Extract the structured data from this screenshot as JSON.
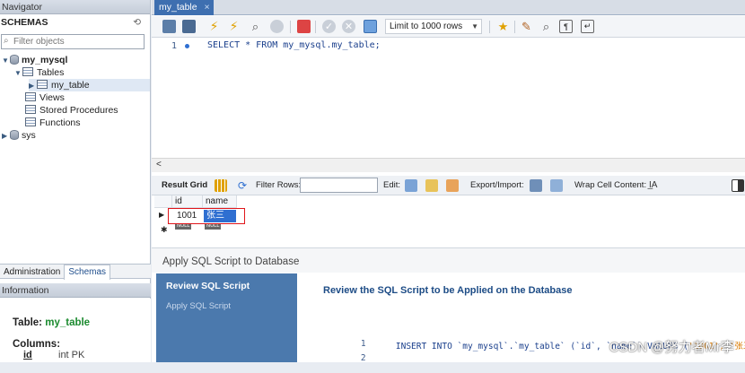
{
  "navigator": {
    "title": "Navigator",
    "schemas_label": "SCHEMAS",
    "refresh_icon": "refresh-icon",
    "filter_placeholder": "Filter objects",
    "tree": {
      "db1": "my_mysql",
      "tables": "Tables",
      "my_table": "my_table",
      "views": "Views",
      "procs": "Stored Procedures",
      "funcs": "Functions",
      "db2": "sys"
    },
    "tabs": {
      "admin": "Administration",
      "schemas": "Schemas"
    },
    "info_title": "Information",
    "info": {
      "table_label": "Table:",
      "table_name": "my_table",
      "columns_label": "Columns:",
      "col_name": "id",
      "col_type": "int PK"
    }
  },
  "editor": {
    "tab_label": "my_table",
    "tab_close": "×",
    "limit": "Limit to 1000 rows",
    "line_no": "1",
    "code": "SELECT * FROM my_mysql.my_table;"
  },
  "result": {
    "grid_label": "Result Grid",
    "filter_rows": "Filter Rows:",
    "edit": "Edit:",
    "export": "Export/Import:",
    "wrap": "Wrap Cell Content:",
    "columns": [
      "id",
      "name"
    ],
    "row": {
      "id": "1001",
      "name": "张三"
    },
    "null_label": "NULL",
    "scroll_left": "<"
  },
  "apply": {
    "header": "Apply SQL Script to Database",
    "step_active": "Review SQL Script",
    "step_next": "Apply SQL Script",
    "title": "Review the SQL Script to be Applied on the Database",
    "line1": "1",
    "line2": "2",
    "sql_kw": "INSERT INTO ",
    "sql_body": "`my_mysql`.`my_table` (`id`, `name`) VALUES (",
    "sql_vals": "'1001', '张三'",
    "sql_end": ");"
  },
  "watermark": "CSDN @努力者Mr李",
  "colors": {
    "accent": "#3e6fb0",
    "side": "#4b79ad",
    "highlight": "#e0161b"
  }
}
